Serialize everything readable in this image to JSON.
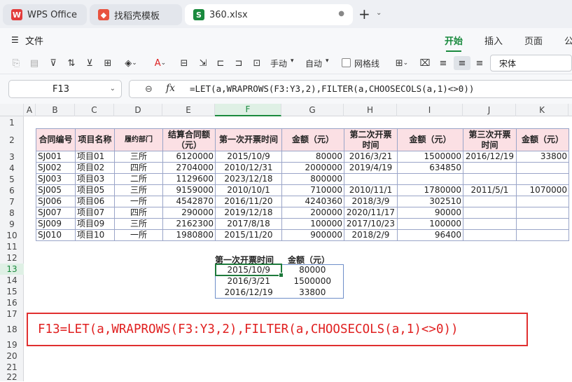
{
  "app": {
    "tabs": [
      {
        "label": "WPS Office",
        "icon": "wps-logo-icon"
      },
      {
        "label": "找稻壳模板",
        "icon": "docer-icon"
      },
      {
        "label": "360.xlsx",
        "icon": "spreadsheet-icon",
        "icon_letter": "S"
      }
    ],
    "menu": {
      "file": "文件",
      "tabs": [
        "开始",
        "插入",
        "页面",
        "公"
      ]
    },
    "toolbar": {
      "wrap_label": "手动",
      "auto_label": "自动",
      "gridlines_label": "网格线",
      "font": "宋体"
    },
    "colors": {
      "accent": "#1a8a3e",
      "header_fill": "#fbe0e4",
      "red_note": "#e02020"
    }
  },
  "formula_bar": {
    "cell_ref": "F13",
    "formula": "=LET(a,WRAPROWS(F3:Y3,2),FILTER(a,CHOOSECOLS(a,1)<>0))"
  },
  "columns": [
    "A",
    "B",
    "C",
    "D",
    "E",
    "F",
    "G",
    "H",
    "I",
    "J",
    "K"
  ],
  "rows": [
    "1",
    "2",
    "3",
    "4",
    "5",
    "6",
    "7",
    "8",
    "9",
    "10",
    "11",
    "12",
    "13",
    "14",
    "15",
    "16",
    "17",
    "18",
    "19",
    "20",
    "21",
    "22"
  ],
  "table": {
    "headers": [
      "合同编号",
      "项目名称",
      "履约部门",
      "结算合同额（元）",
      "第一次开票时间",
      "金额（元）",
      "第二次开票时间",
      "金额（元）",
      "第三次开票时间",
      "金额（元）"
    ],
    "rows": [
      [
        "SJ001",
        "项目01",
        "三所",
        "6120000",
        "2015/10/9",
        "80000",
        "2016/3/21",
        "1500000",
        "2016/12/19",
        "33800"
      ],
      [
        "SJ002",
        "项目02",
        "四所",
        "2704000",
        "2010/12/31",
        "2000000",
        "2019/4/19",
        "634850",
        "",
        ""
      ],
      [
        "SJ003",
        "项目03",
        "二所",
        "1129600",
        "2023/12/18",
        "800000",
        "",
        "",
        "",
        ""
      ],
      [
        "SJ005",
        "项目05",
        "三所",
        "9159000",
        "2010/10/1",
        "710000",
        "2010/11/1",
        "1780000",
        "2011/5/1",
        "1070000"
      ],
      [
        "SJ006",
        "项目06",
        "一所",
        "4542870",
        "2016/11/20",
        "4240360",
        "2018/3/9",
        "302510",
        "",
        ""
      ],
      [
        "SJ007",
        "项目07",
        "四所",
        "290000",
        "2019/12/18",
        "200000",
        "2020/11/17",
        "90000",
        "",
        ""
      ],
      [
        "SJ009",
        "项目09",
        "三所",
        "2162300",
        "2017/8/18",
        "100000",
        "2017/10/23",
        "100000",
        "",
        ""
      ],
      [
        "SJ010",
        "项目10",
        "一所",
        "1980800",
        "2015/11/20",
        "900000",
        "2018/2/9",
        "96400",
        "",
        ""
      ]
    ]
  },
  "result": {
    "headers": [
      "第一次开票时间",
      "金额（元）"
    ],
    "rows": [
      [
        "2015/10/9",
        "80000"
      ],
      [
        "2016/3/21",
        "1500000"
      ],
      [
        "2016/12/19",
        "33800"
      ]
    ]
  },
  "note": "F13=LET(a,WRAPROWS(F3:Y3,2),FILTER(a,CHOOSECOLS(a,1)<>0))"
}
